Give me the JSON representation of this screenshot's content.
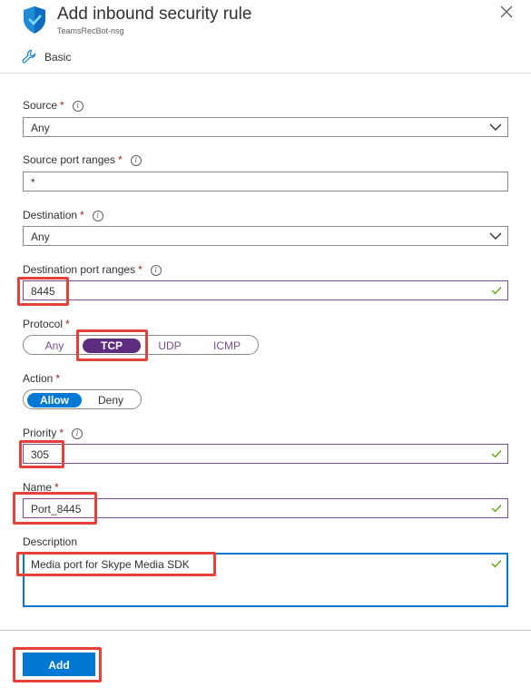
{
  "header": {
    "title": "Add inbound security rule",
    "subtitle": "TeamsRecBot-nsg",
    "mode_label": "Basic"
  },
  "form": {
    "source": {
      "label": "Source",
      "required": "*",
      "value": "Any"
    },
    "source_port_ranges": {
      "label": "Source port ranges",
      "required": "*",
      "value": "*"
    },
    "destination": {
      "label": "Destination",
      "required": "*",
      "value": "Any"
    },
    "destination_port_ranges": {
      "label": "Destination port ranges",
      "required": "*",
      "value": "8445"
    },
    "protocol": {
      "label": "Protocol",
      "required": "*",
      "options": [
        "Any",
        "TCP",
        "UDP",
        "ICMP"
      ],
      "selected": "TCP"
    },
    "action": {
      "label": "Action",
      "required": "*",
      "options": [
        "Allow",
        "Deny"
      ],
      "selected": "Allow"
    },
    "priority": {
      "label": "Priority",
      "required": "*",
      "value": "305"
    },
    "name": {
      "label": "Name",
      "required": "*",
      "value": "Port_8445"
    },
    "description": {
      "label": "Description",
      "value": "Media port for Skype Media SDK"
    }
  },
  "footer": {
    "add_label": "Add"
  },
  "colors": {
    "accent": "#0078d4",
    "selected_protocol": "#5c2d7f",
    "highlight": "#e5403a",
    "required": "#a4262c"
  }
}
